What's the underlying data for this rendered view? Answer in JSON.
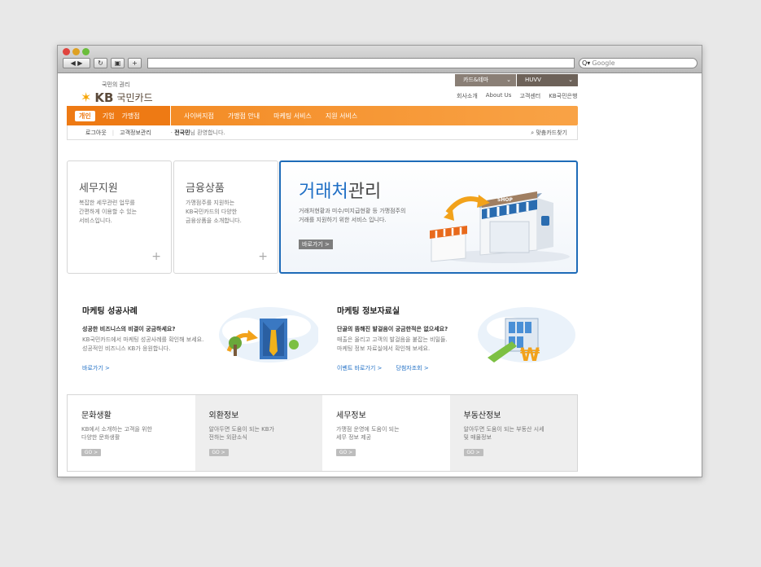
{
  "browser": {
    "search_placeholder": "Google"
  },
  "header": {
    "logo_sub": "국민의 권리",
    "logo_kb": "KB",
    "logo_name": "국민카드",
    "select1": "카드&테마",
    "select2": "HUVV",
    "top_links": [
      "회사소개",
      "About Us",
      "고객센터",
      "KB국민은행"
    ]
  },
  "gnb": {
    "left": [
      "개인",
      "기업",
      "가맹점"
    ],
    "right": [
      "사이버지점",
      "가맹점 안내",
      "마케팅 서비스",
      "지원 서비스"
    ]
  },
  "subbar": {
    "logout": "로그아웃",
    "account": "고객정보관리",
    "user_name": "전국민",
    "welcome_suffix": "님 환영합니다.",
    "card_find": "맞춤카드찾기"
  },
  "boxes": [
    {
      "title": "세무지원",
      "desc": [
        "복잡한 세무관련 업무를",
        "간편하게 이용할 수 있는",
        "서비스입니다."
      ]
    },
    {
      "title": "금융상품",
      "desc": [
        "가맹점주를 지원하는",
        "KB국민카드의 다양한",
        "금융상품을 소개합니다."
      ]
    }
  ],
  "feature": {
    "title_blue": "거래처",
    "title_rest": "관리",
    "desc": [
      "거래처현황과 미수/미지급현황 등 가맹점주의",
      "거래를 지원하기 위한 서비스 입니다."
    ],
    "button": "바로가기 >",
    "shop_sign": "SHOP"
  },
  "marketing": [
    {
      "title": "마케팅 성공사례",
      "question": "성공한 비즈니스의 비결이 궁금하세요?",
      "desc": [
        "KB국민카드에서 마케팅 성공사례를 확인해 보세요.",
        "성공적인 비즈니스 KB가 응원합니다."
      ],
      "links": [
        "바로가기 >"
      ]
    },
    {
      "title": "마케팅 정보자료실",
      "question": "단골의 뜸해진 발걸음이 궁금한적은 없으세요?",
      "desc": [
        "매출은 올리고 고객의 발걸음을 붙잡는 비밀들.",
        "마케팅 정보 자료실에서 확인해 보세요."
      ],
      "links": [
        "이벤트 바로가기 >",
        "당첨자조회 >"
      ]
    }
  ],
  "info": [
    {
      "title": "문화생활",
      "desc": [
        "KB에서 소개하는 고객을 위한",
        "다양한 문화생활"
      ],
      "go": "GO >"
    },
    {
      "title": "외환정보",
      "desc": [
        "알아두면 도움이 되는 KB가",
        "전하는 외환소식"
      ],
      "go": "GO >"
    },
    {
      "title": "세무정보",
      "desc": [
        "가맹점 운영에 도움이 되는",
        "세무 정보 제공"
      ],
      "go": "GO >"
    },
    {
      "title": "부동산정보",
      "desc": [
        "알아두면 도움이 되는 부동산 시세",
        "및 매물정보"
      ],
      "go": "GO >"
    }
  ]
}
